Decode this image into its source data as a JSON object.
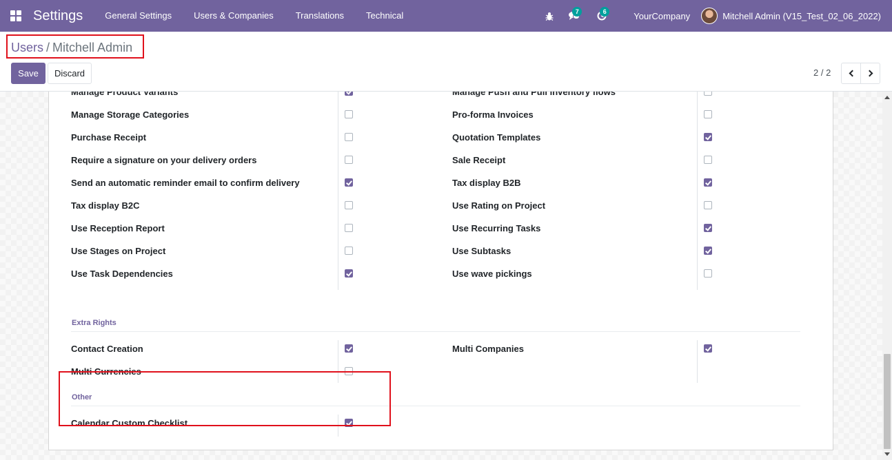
{
  "colors": {
    "brand": "#71639e",
    "badge": "#00a09d",
    "highlight": "#e0101b"
  },
  "navbar": {
    "app_title": "Settings",
    "menu": [
      "General Settings",
      "Users & Companies",
      "Translations",
      "Technical"
    ],
    "messages_count": "7",
    "activities_count": "6",
    "company": "YourCompany",
    "user": "Mitchell Admin (V15_Test_02_06_2022)"
  },
  "breadcrumb": {
    "parent": "Users",
    "separator": "/",
    "current": "Mitchell Admin"
  },
  "buttons": {
    "save": "Save",
    "discard": "Discard"
  },
  "pager": {
    "value": "2 / 2"
  },
  "technical_rights": {
    "left": [
      {
        "label": "Manage Product Variants",
        "checked": true
      },
      {
        "label": "Manage Storage Categories",
        "checked": false
      },
      {
        "label": "Purchase Receipt",
        "checked": false
      },
      {
        "label": "Require a signature on your delivery orders",
        "checked": false
      },
      {
        "label": "Send an automatic reminder email to confirm delivery",
        "checked": true
      },
      {
        "label": "Tax display B2C",
        "checked": false
      },
      {
        "label": "Use Reception Report",
        "checked": false
      },
      {
        "label": "Use Stages on Project",
        "checked": false
      },
      {
        "label": "Use Task Dependencies",
        "checked": true
      }
    ],
    "right": [
      {
        "label": "Manage Push and Pull inventory flows",
        "checked": false
      },
      {
        "label": "Pro-forma Invoices",
        "checked": false
      },
      {
        "label": "Quotation Templates",
        "checked": true
      },
      {
        "label": "Sale Receipt",
        "checked": false
      },
      {
        "label": "Tax display B2B",
        "checked": true
      },
      {
        "label": "Use Rating on Project",
        "checked": false
      },
      {
        "label": "Use Recurring Tasks",
        "checked": true
      },
      {
        "label": "Use Subtasks",
        "checked": true
      },
      {
        "label": "Use wave pickings",
        "checked": false
      }
    ]
  },
  "extra_rights": {
    "title": "Extra Rights",
    "left": [
      {
        "label": "Contact Creation",
        "checked": true
      },
      {
        "label": "Multi Currencies",
        "checked": false
      }
    ],
    "right": [
      {
        "label": "Multi Companies",
        "checked": true
      }
    ]
  },
  "other": {
    "title": "Other",
    "left": [
      {
        "label": "Calendar Custom Checklist",
        "checked": true
      }
    ]
  }
}
